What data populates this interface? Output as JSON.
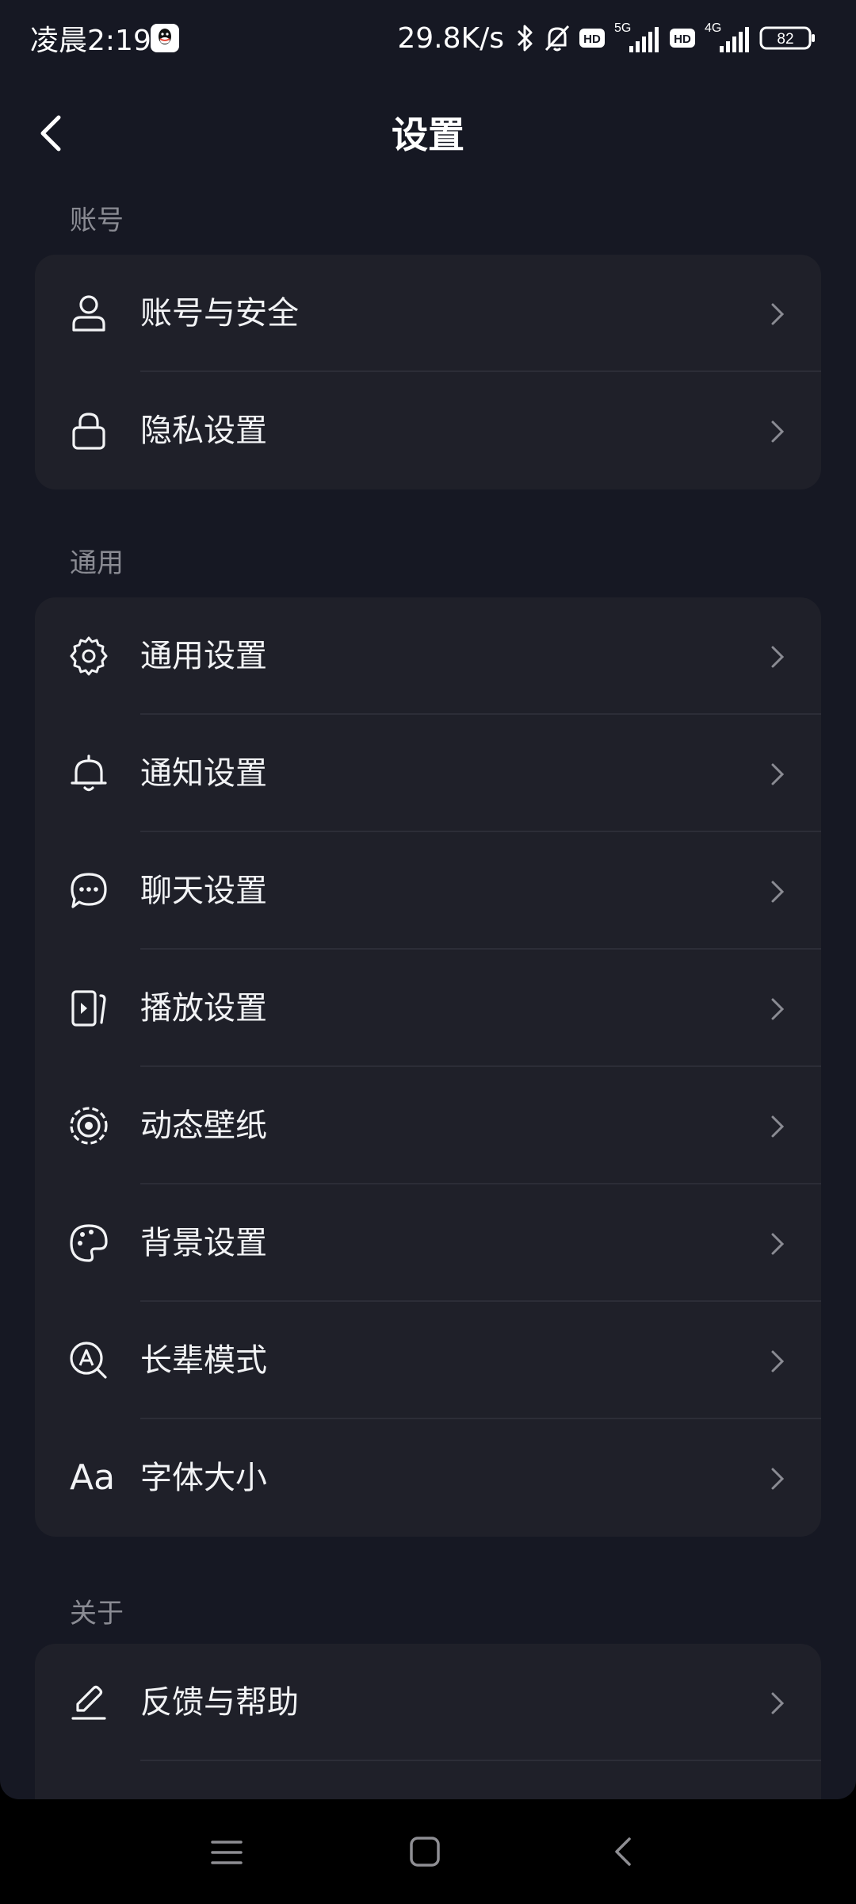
{
  "status_bar": {
    "time": "凌晨2:19",
    "speed": "29.8K/s",
    "hd": "HD",
    "net1": "5G",
    "net2": "4G",
    "battery": "82"
  },
  "header": {
    "title": "设置"
  },
  "sections": [
    {
      "label": "账号",
      "items": [
        "账号与安全",
        "隐私设置"
      ]
    },
    {
      "label": "通用",
      "items": [
        "通用设置",
        "通知设置",
        "聊天设置",
        "播放设置",
        "动态壁纸",
        "背景设置",
        "长辈模式",
        "字体大小"
      ]
    },
    {
      "label": "关于",
      "items": [
        "反馈与帮助"
      ]
    }
  ],
  "font_size_icon_text": "Aa",
  "icons": {
    "account": "person-icon",
    "privacy": "lock-icon",
    "general": "gear-icon",
    "notify": "bell-icon",
    "chat": "chat-bubble-icon",
    "play": "play-screen-icon",
    "wallpaper": "wallpaper-target-icon",
    "background": "palette-icon",
    "elder": "elder-mode-icon",
    "font": "font-size-icon",
    "feedback": "pen-icon"
  },
  "colors": {
    "background": "#161823",
    "card": "#1f2029",
    "section_label": "#8a8b93",
    "text": "#f2f3f5"
  }
}
